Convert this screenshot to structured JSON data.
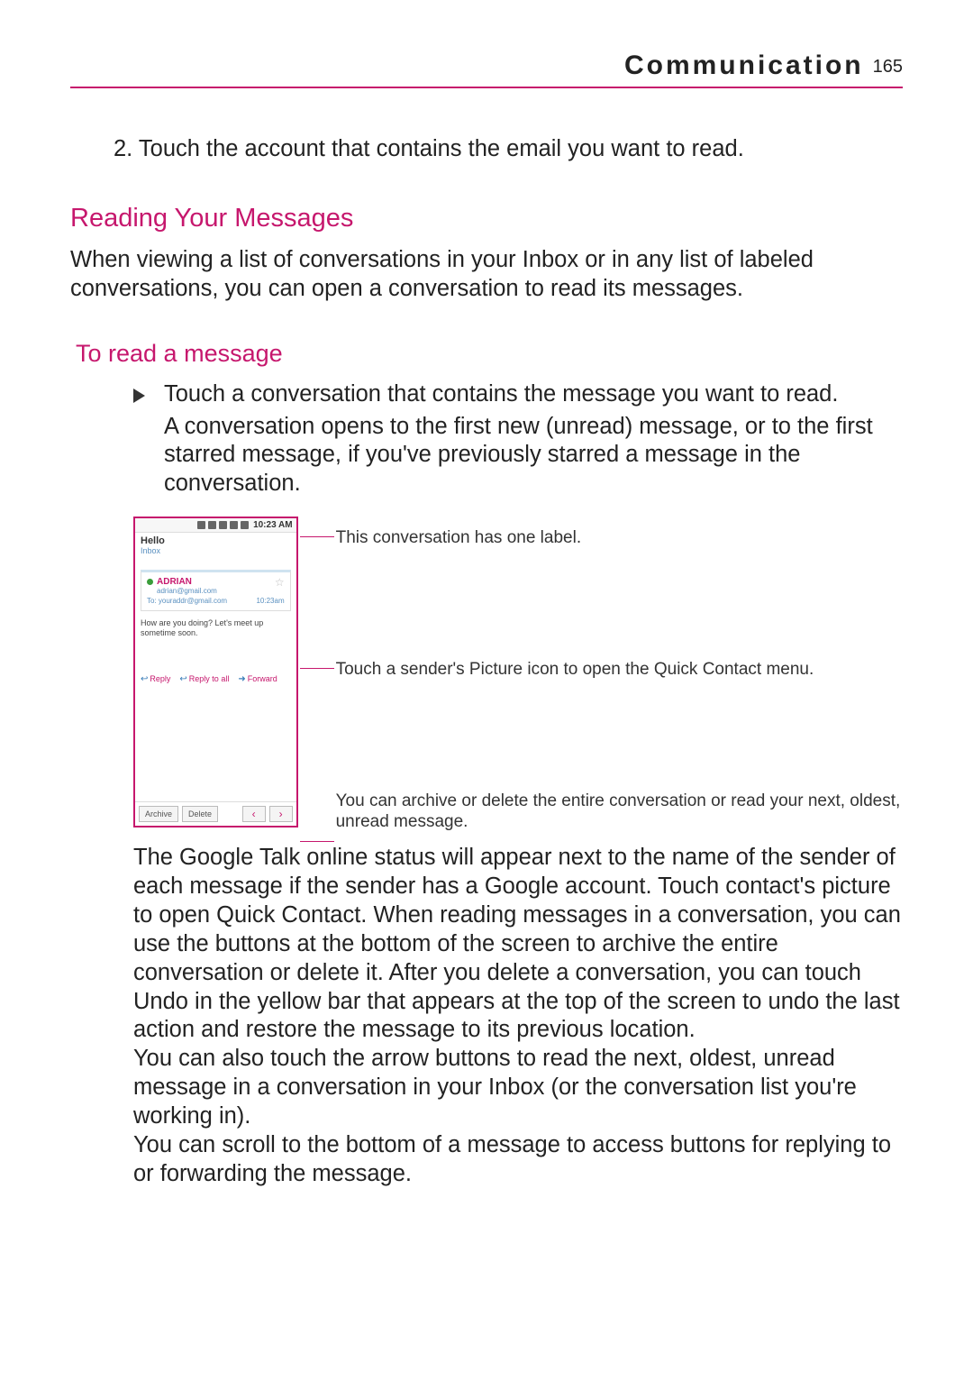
{
  "header": {
    "section_title": "Communication",
    "page_number": "165"
  },
  "step2": "2. Touch the account that contains the email you want to read.",
  "h_reading": "Reading Your Messages",
  "reading_intro": "When viewing a list of conversations in your Inbox or in any list of labeled conversations, you can open a conversation to read its messages.",
  "h_to_read": "To read a message",
  "bullet_touch": "Touch a conversation that contains the message you want to read.",
  "bullet_expl": "A conversation opens to the first new (unread) message, or to the first starred message, if you've previously starred a message in the conversation.",
  "phone": {
    "time": "10:23 AM",
    "subject": "Hello",
    "label": "Inbox",
    "sender": "ADRIAN",
    "sender_addr": "adrian@gmail.com",
    "to_prefix": "To:",
    "to_addr": "youraddr@gmail.com",
    "msg_time": "10:23am",
    "body": "How are you doing? Let's meet up sometime soon.",
    "reply": "Reply",
    "reply_all": "Reply to all",
    "forward": "Forward",
    "archive": "Archive",
    "delete": "Delete"
  },
  "anno": {
    "label": "This conversation has one label.",
    "picture": "Touch a sender's Picture icon to open the Quick Contact menu.",
    "archive": "You can archive or delete the entire conversation or read your next, oldest, unread message."
  },
  "para_googletalk": "The Google Talk online status will appear next to the name of the sender of each message if the sender has a Google account. Touch contact's picture to open Quick Contact. When reading messages in a conversation, you can use the buttons at the bottom of the screen to archive the entire conversation or delete it. After you delete a conversation, you can touch Undo in the yellow bar that appears at the top of the screen to undo the last action and restore the message to its previous location.",
  "para_arrows": "You can also touch the arrow buttons to read the next, oldest, unread message in a conversation in your Inbox (or the conversation list you're working in).",
  "para_scroll": "You can scroll to the bottom of a message to access buttons for replying to or forwarding the message."
}
